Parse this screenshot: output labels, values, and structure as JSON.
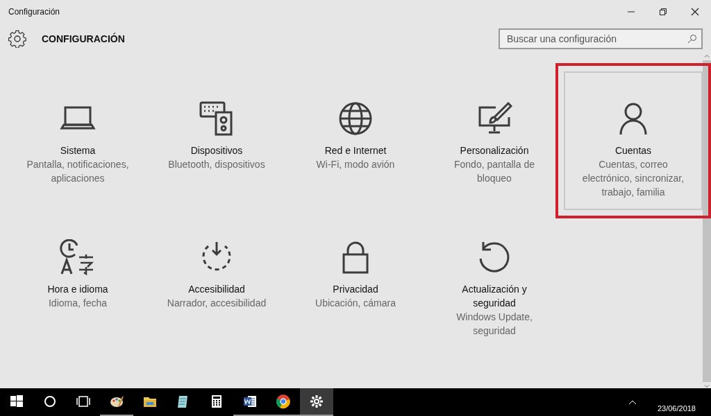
{
  "window": {
    "title": "Configuración"
  },
  "header": {
    "title": "CONFIGURACIÓN"
  },
  "search": {
    "placeholder": "Buscar una configuración"
  },
  "tiles": [
    {
      "title": "Sistema",
      "description": "Pantalla, notificaciones, aplicaciones",
      "selected": false
    },
    {
      "title": "Dispositivos",
      "description": "Bluetooth, dispositivos",
      "selected": false
    },
    {
      "title": "Red e Internet",
      "description": "Wi-Fi, modo avión",
      "selected": false
    },
    {
      "title": "Personalización",
      "description": "Fondo, pantalla de bloqueo",
      "selected": false
    },
    {
      "title": "Cuentas",
      "description": "Cuentas, correo electrónico, sincronizar, trabajo, familia",
      "selected": true
    },
    {
      "title": "Hora e idioma",
      "description": "Idioma, fecha",
      "selected": false
    },
    {
      "title": "Accesibilidad",
      "description": "Narrador, accesibilidad",
      "selected": false
    },
    {
      "title": "Privacidad",
      "description": "Ubicación, cámara",
      "selected": false
    },
    {
      "title": "Actualización y seguridad",
      "description": "Windows Update, seguridad",
      "selected": false
    }
  ],
  "taskbar": {
    "apps": [
      {
        "running": false,
        "selected": false
      },
      {
        "running": false,
        "selected": false
      },
      {
        "running": false,
        "selected": false
      },
      {
        "running": true,
        "selected": false
      },
      {
        "running": false,
        "selected": false
      },
      {
        "running": false,
        "selected": false
      },
      {
        "running": false,
        "selected": false
      },
      {
        "running": true,
        "selected": false
      },
      {
        "running": true,
        "selected": false
      },
      {
        "running": true,
        "selected": true
      }
    ],
    "date": "23/06/2018"
  }
}
